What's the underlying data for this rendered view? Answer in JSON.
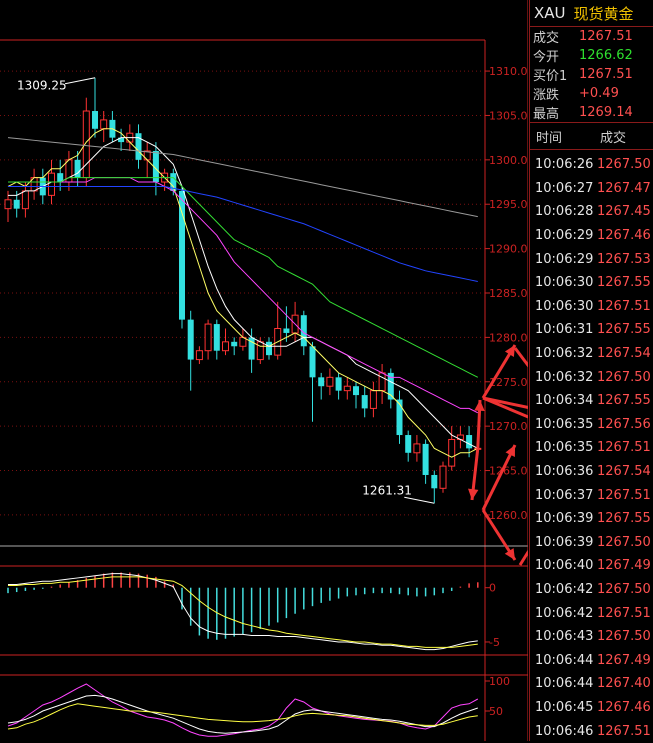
{
  "quote": {
    "symbol": "XAU",
    "name": "现货黄金",
    "rows": [
      {
        "label": "成交",
        "value": "1267.51",
        "color": "#ff5050"
      },
      {
        "label": "今开",
        "value": "1266.62",
        "color": "#2ee02e"
      },
      {
        "label": "买价1",
        "value": "1267.51",
        "color": "#ff5050"
      },
      {
        "label": "涨跌",
        "value": "+0.49",
        "color": "#ff5050"
      },
      {
        "label": "最高",
        "value": "1269.14",
        "color": "#ff5050"
      }
    ],
    "ticks_header": {
      "time": "时间",
      "price": "成交"
    },
    "ticks": [
      {
        "time": "10:06:26",
        "price": "1267.50"
      },
      {
        "time": "10:06:27",
        "price": "1267.47"
      },
      {
        "time": "10:06:28",
        "price": "1267.45"
      },
      {
        "time": "10:06:29",
        "price": "1267.46"
      },
      {
        "time": "10:06:29",
        "price": "1267.53"
      },
      {
        "time": "10:06:30",
        "price": "1267.55"
      },
      {
        "time": "10:06:30",
        "price": "1267.51"
      },
      {
        "time": "10:06:31",
        "price": "1267.55"
      },
      {
        "time": "10:06:32",
        "price": "1267.54"
      },
      {
        "time": "10:06:32",
        "price": "1267.50"
      },
      {
        "time": "10:06:34",
        "price": "1267.55"
      },
      {
        "time": "10:06:35",
        "price": "1267.56"
      },
      {
        "time": "10:06:35",
        "price": "1267.51"
      },
      {
        "time": "10:06:36",
        "price": "1267.54"
      },
      {
        "time": "10:06:37",
        "price": "1267.51"
      },
      {
        "time": "10:06:39",
        "price": "1267.55"
      },
      {
        "time": "10:06:39",
        "price": "1267.50"
      },
      {
        "time": "10:06:40",
        "price": "1267.49"
      },
      {
        "time": "10:06:42",
        "price": "1267.50"
      },
      {
        "time": "10:06:42",
        "price": "1267.51"
      },
      {
        "time": "10:06:43",
        "price": "1267.50"
      },
      {
        "time": "10:06:44",
        "price": "1267.49"
      },
      {
        "time": "10:06:44",
        "price": "1267.40"
      },
      {
        "time": "10:06:45",
        "price": "1267.46"
      },
      {
        "time": "10:06:46",
        "price": "1267.51"
      }
    ]
  },
  "chart_data": {
    "type": "candlestick",
    "price_axis": {
      "ylim": [
        1256.5,
        1313.5
      ],
      "ticks": [
        1310.0,
        1305.0,
        1300.0,
        1295.0,
        1290.0,
        1285.0,
        1280.0,
        1275.0,
        1270.0,
        1265.0,
        1260.0
      ]
    },
    "annotations": [
      {
        "text": "1309.25",
        "value": 1309.25
      },
      {
        "text": "1261.31",
        "value": 1261.31
      }
    ],
    "candles": [
      [
        1294.5,
        1295.5,
        1293,
        1296.5
      ],
      [
        1295.5,
        1294.5,
        1293.5,
        1296.5
      ],
      [
        1294.5,
        1296.5,
        1293.5,
        1297.5
      ],
      [
        1296.5,
        1298,
        1295.5,
        1299
      ],
      [
        1298,
        1296,
        1295,
        1299
      ],
      [
        1296,
        1298.5,
        1295,
        1300
      ],
      [
        1298.5,
        1297.5,
        1296.5,
        1300
      ],
      [
        1297.5,
        1300,
        1296.5,
        1301
      ],
      [
        1300,
        1298,
        1297,
        1301
      ],
      [
        1298,
        1305.5,
        1297,
        1307
      ],
      [
        1305.5,
        1303.5,
        1302.5,
        1309.25
      ],
      [
        1303.5,
        1304.5,
        1302,
        1305.5
      ],
      [
        1304.5,
        1302.5,
        1302,
        1305.5
      ],
      [
        1302.5,
        1302,
        1301,
        1303.5
      ],
      [
        1302,
        1303,
        1301,
        1304
      ],
      [
        1303,
        1300,
        1299,
        1304
      ],
      [
        1300,
        1301,
        1298,
        1302
      ],
      [
        1301,
        1297.5,
        1296,
        1302
      ],
      [
        1297.5,
        1298.5,
        1296.5,
        1299
      ],
      [
        1298.5,
        1296.5,
        1296,
        1299
      ],
      [
        1296.5,
        1282,
        1281,
        1297
      ],
      [
        1282,
        1277.5,
        1274,
        1283
      ],
      [
        1277.5,
        1278.5,
        1277,
        1279
      ],
      [
        1278.5,
        1281.5,
        1277.5,
        1282
      ],
      [
        1281.5,
        1278.5,
        1277.5,
        1282
      ],
      [
        1278.5,
        1279.5,
        1278,
        1281
      ],
      [
        1279.5,
        1279,
        1278,
        1280
      ],
      [
        1279,
        1280,
        1278.5,
        1281
      ],
      [
        1280,
        1277.5,
        1276,
        1281
      ],
      [
        1277.5,
        1279.5,
        1277,
        1280
      ],
      [
        1279.5,
        1278,
        1277.5,
        1280
      ],
      [
        1278,
        1281,
        1277.5,
        1284
      ],
      [
        1281,
        1280.5,
        1279.5,
        1283.5
      ],
      [
        1280.5,
        1282.5,
        1279.5,
        1284
      ],
      [
        1282.5,
        1279,
        1278,
        1283
      ],
      [
        1279,
        1275.5,
        1270.5,
        1279.5
      ],
      [
        1275.5,
        1274.5,
        1273,
        1276
      ],
      [
        1274.5,
        1275.5,
        1273.5,
        1276.5
      ],
      [
        1275.5,
        1274,
        1273,
        1276
      ],
      [
        1274,
        1274.5,
        1273,
        1275.5
      ],
      [
        1274.5,
        1273.5,
        1272,
        1275
      ],
      [
        1273.5,
        1272,
        1271,
        1274.5
      ],
      [
        1272,
        1274,
        1271,
        1275
      ],
      [
        1274,
        1276,
        1272.5,
        1277
      ],
      [
        1276,
        1273,
        1272,
        1276.5
      ],
      [
        1273,
        1269,
        1268,
        1274
      ],
      [
        1269,
        1267,
        1266,
        1269.5
      ],
      [
        1267,
        1268,
        1266,
        1269
      ],
      [
        1268,
        1264.5,
        1263.5,
        1268.5
      ],
      [
        1264.5,
        1263,
        1261.31,
        1265
      ],
      [
        1263,
        1265.5,
        1262.5,
        1266
      ],
      [
        1265.5,
        1268.5,
        1265,
        1270
      ],
      [
        1268.5,
        1269,
        1267.5,
        1270
      ],
      [
        1269,
        1267.5,
        1266.5,
        1270
      ],
      [
        1267.5,
        1267.5,
        1267,
        1268
      ]
    ],
    "ma_lines": [
      {
        "color": "#ffff66",
        "values": [
          1297,
          1297.5,
          1297,
          1298,
          1298,
          1299,
          1299,
          1300,
          1300.5,
          1302,
          1303,
          1303.5,
          1303.5,
          1303,
          1302,
          1301,
          1300,
          1299,
          1298,
          1297,
          1294,
          1291,
          1288,
          1285,
          1283,
          1282,
          1281,
          1280,
          1279.5,
          1279,
          1279,
          1279.5,
          1280,
          1280.5,
          1280,
          1279,
          1278,
          1277,
          1276,
          1275.5,
          1275,
          1274.5,
          1274,
          1274,
          1273.5,
          1272.5,
          1271,
          1270,
          1269,
          1267.5,
          1267,
          1266.5,
          1267,
          1267,
          1267.5
        ]
      },
      {
        "color": "#ffffff",
        "values": [
          1296,
          1296,
          1296.5,
          1296.5,
          1297,
          1297.5,
          1297.5,
          1298,
          1298.5,
          1299.5,
          1300.5,
          1301.5,
          1302,
          1302.5,
          1302.5,
          1302.5,
          1302,
          1301.5,
          1300.5,
          1299.5,
          1297,
          1294,
          1291,
          1288,
          1285.5,
          1283.5,
          1282,
          1281,
          1280,
          1279.5,
          1279,
          1279,
          1279,
          1279.5,
          1280,
          1280,
          1279.5,
          1279,
          1278.5,
          1278,
          1277,
          1276.5,
          1276,
          1275.5,
          1275,
          1274.5,
          1274,
          1273,
          1272,
          1271,
          1270,
          1269,
          1268.5,
          1268,
          1267.5
        ]
      },
      {
        "color": "#ff44ff",
        "values": [
          1297.5,
          1297.5,
          1297.5,
          1297.5,
          1297.5,
          1297.5,
          1297.5,
          1297.5,
          1297.5,
          1297.5,
          1298,
          1298,
          1298,
          1298,
          1298,
          1297.5,
          1297.5,
          1297.5,
          1297,
          1296.5,
          1295.5,
          1294.5,
          1293.5,
          1292.5,
          1291.5,
          1290,
          1288.5,
          1287.5,
          1286.5,
          1285.5,
          1284.5,
          1283.5,
          1282.5,
          1281.5,
          1280.5,
          1280,
          1279.5,
          1279,
          1278.5,
          1278,
          1277.5,
          1277,
          1276.5,
          1276,
          1275.5,
          1275.5,
          1275,
          1274.5,
          1274,
          1273.5,
          1273,
          1272.5,
          1272,
          1272,
          1271.5
        ]
      },
      {
        "color": "#33dd33",
        "values": [
          1297.5,
          1297.5,
          1297.5,
          1297.5,
          1297.5,
          1297.5,
          1297.5,
          1298,
          1298,
          1298,
          1298,
          1298,
          1298,
          1298,
          1298,
          1298,
          1298,
          1298,
          1298,
          1298,
          1297,
          1296,
          1295,
          1294,
          1293,
          1292,
          1291,
          1290.5,
          1290,
          1289.5,
          1289,
          1288,
          1287.5,
          1287,
          1286.5,
          1286,
          1285,
          1284,
          1283.5,
          1283,
          1282.5,
          1282,
          1281.5,
          1281,
          1280.5,
          1280,
          1279.5,
          1279,
          1278.5,
          1278,
          1277.5,
          1277,
          1276.5,
          1276,
          1275.5
        ]
      },
      {
        "color": "#2244ff",
        "values": [
          1297,
          1297,
          1297,
          1297,
          1297,
          1297,
          1297,
          1297,
          1297,
          1297,
          1297,
          1297,
          1297,
          1297,
          1297,
          1297,
          1297,
          1297,
          1297,
          1296.8,
          1296.6,
          1296.4,
          1296.2,
          1296,
          1295.8,
          1295.5,
          1295.2,
          1294.9,
          1294.6,
          1294.3,
          1294,
          1293.7,
          1293.4,
          1293.1,
          1292.8,
          1292.4,
          1292,
          1291.6,
          1291.2,
          1290.8,
          1290.4,
          1290,
          1289.6,
          1289.2,
          1288.8,
          1288.4,
          1288.1,
          1287.8,
          1287.5,
          1287.3,
          1287.1,
          1286.9,
          1286.7,
          1286.5,
          1286.3
        ]
      },
      {
        "color": "#999999",
        "values": [
          1302.5,
          1302.4,
          1302.3,
          1302.2,
          1302.1,
          1302,
          1301.9,
          1301.8,
          1301.7,
          1301.6,
          1301.5,
          1301.4,
          1301.3,
          1301.2,
          1301.1,
          1301,
          1300.9,
          1300.8,
          1300.7,
          1300.6,
          1300.4,
          1300.2,
          1300,
          1299.8,
          1299.6,
          1299.4,
          1299.2,
          1299,
          1298.8,
          1298.6,
          1298.4,
          1298.2,
          1298,
          1297.8,
          1297.6,
          1297.4,
          1297.2,
          1297,
          1296.8,
          1296.6,
          1296.4,
          1296.2,
          1296,
          1295.8,
          1295.6,
          1295.4,
          1295.2,
          1295,
          1294.8,
          1294.6,
          1294.4,
          1294.2,
          1294,
          1293.8,
          1293.6
        ]
      }
    ],
    "macd": {
      "ylim": [
        -6.2,
        2
      ],
      "ticks": [
        {
          "text": "0",
          "value": 0
        },
        {
          "text": "-5",
          "value": -5
        }
      ],
      "hist": [
        -0.5,
        -0.4,
        -0.3,
        -0.2,
        -0.1,
        0.1,
        0.3,
        0.5,
        0.7,
        0.9,
        1.1,
        1.3,
        1.4,
        1.4,
        1.4,
        1.3,
        1.2,
        1.0,
        0.6,
        0.3,
        -2,
        -3.5,
        -4.4,
        -4.7,
        -4.8,
        -4.7,
        -4.5,
        -4.3,
        -4.1,
        -3.8,
        -3.5,
        -3.2,
        -2.8,
        -2.4,
        -2.0,
        -1.7,
        -1.4,
        -1.2,
        -1.0,
        -0.8,
        -0.7,
        -0.6,
        -0.5,
        -0.5,
        -0.5,
        -0.6,
        -0.7,
        -0.8,
        -0.8,
        -0.7,
        -0.5,
        -0.3,
        0.1,
        0.4,
        0.5
      ],
      "dif": [
        0.3,
        0.3,
        0.4,
        0.5,
        0.6,
        0.6,
        0.7,
        0.8,
        0.9,
        1.0,
        1.1,
        1.2,
        1.3,
        1.3,
        1.2,
        1.1,
        0.9,
        0.7,
        0.4,
        0.1,
        -1.5,
        -2.8,
        -3.6,
        -4,
        -4.2,
        -4.3,
        -4.3,
        -4.3,
        -4.4,
        -4.4,
        -4.4,
        -4.5,
        -4.5,
        -4.5,
        -4.6,
        -4.7,
        -4.8,
        -4.9,
        -5.0,
        -5.0,
        -5.1,
        -5.2,
        -5.2,
        -5.3,
        -5.3,
        -5.4,
        -5.5,
        -5.6,
        -5.7,
        -5.7,
        -5.6,
        -5.4,
        -5.2,
        -5.0,
        -4.9
      ],
      "dea": [
        0.2,
        0.2,
        0.3,
        0.3,
        0.4,
        0.4,
        0.5,
        0.5,
        0.6,
        0.7,
        0.8,
        0.9,
        1.0,
        1.0,
        1.0,
        1.0,
        0.9,
        0.8,
        0.7,
        0.6,
        0.2,
        -0.5,
        -1.2,
        -1.8,
        -2.3,
        -2.7,
        -3.0,
        -3.3,
        -3.5,
        -3.7,
        -3.9,
        -4.0,
        -4.2,
        -4.3,
        -4.4,
        -4.5,
        -4.6,
        -4.7,
        -4.8,
        -4.9,
        -5.0,
        -5.0,
        -5.1,
        -5.2,
        -5.2,
        -5.3,
        -5.4,
        -5.4,
        -5.5,
        -5.5,
        -5.5,
        -5.5,
        -5.4,
        -5.3,
        -5.2
      ]
    },
    "kdj": {
      "ylim": [
        0,
        110
      ],
      "ticks": [
        {
          "text": "100",
          "value": 100
        },
        {
          "text": "50",
          "value": 50
        }
      ],
      "k": [
        25,
        30,
        40,
        50,
        60,
        65,
        72,
        80,
        88,
        95,
        85,
        75,
        65,
        58,
        50,
        45,
        40,
        38,
        35,
        30,
        22,
        15,
        10,
        8,
        8,
        10,
        12,
        15,
        18,
        20,
        25,
        35,
        55,
        70,
        65,
        55,
        50,
        45,
        42,
        40,
        38,
        36,
        35,
        34,
        33,
        30,
        25,
        22,
        20,
        25,
        40,
        55,
        60,
        62,
        70
      ],
      "d": [
        30,
        32,
        36,
        42,
        50,
        55,
        60,
        65,
        70,
        75,
        76,
        74,
        70,
        65,
        60,
        55,
        50,
        46,
        42,
        38,
        32,
        26,
        20,
        16,
        14,
        13,
        14,
        15,
        16,
        18,
        20,
        25,
        35,
        45,
        50,
        52,
        50,
        48,
        46,
        44,
        42,
        40,
        38,
        36,
        35,
        33,
        30,
        27,
        24,
        24,
        30,
        38,
        45,
        50,
        55
      ],
      "j": [
        20,
        22,
        28,
        32,
        38,
        45,
        52,
        58,
        62,
        60,
        58,
        56,
        54,
        52,
        50,
        50,
        49,
        48,
        46,
        44,
        42,
        40,
        38,
        36,
        35,
        34,
        33,
        32,
        32,
        33,
        34,
        36,
        38,
        42,
        45,
        46,
        45,
        44,
        43,
        42,
        40,
        38,
        36,
        34,
        32,
        30,
        28,
        27,
        26,
        26,
        28,
        32,
        36,
        40,
        42
      ]
    }
  }
}
